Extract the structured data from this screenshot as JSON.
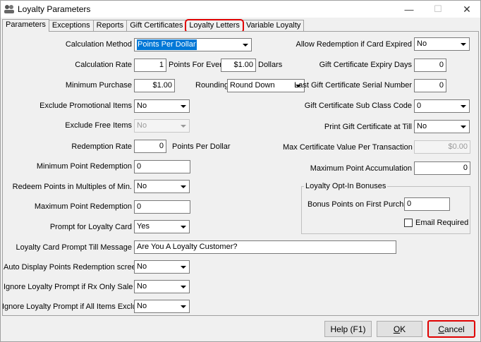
{
  "window": {
    "title": "Loyalty Parameters",
    "minimize": "—",
    "maximize": "☐",
    "close": "✕"
  },
  "tabs": [
    {
      "label": "Parameters",
      "active": true
    },
    {
      "label": "Exceptions"
    },
    {
      "label": "Reports"
    },
    {
      "label": "Gift Certificates"
    },
    {
      "label": "Loyalty Letters",
      "highlighted": true,
      "highlight_color": "#e00000"
    },
    {
      "label": "Variable Loyalty"
    }
  ],
  "left": {
    "calculation_method": {
      "label": "Calculation Method",
      "value": "Points Per Dollar"
    },
    "calculation_rate": {
      "label": "Calculation Rate",
      "value": "1",
      "mid_label": "Points For Every",
      "amount": "$1.00",
      "suffix": "Dollars"
    },
    "minimum_purchase": {
      "label": "Minimum Purchase",
      "value": "$1.00",
      "rounding_label": "Rounding",
      "rounding_value": "Round Down"
    },
    "exclude_promotional": {
      "label": "Exclude Promotional Items",
      "value": "No"
    },
    "exclude_free": {
      "label": "Exclude Free Items",
      "value": "No"
    },
    "redemption_rate": {
      "label": "Redemption Rate",
      "value": "0",
      "suffix": "Points Per Dollar"
    },
    "minimum_point_redemption": {
      "label": "Minimum Point Redemption",
      "value": "0"
    },
    "redeem_multiples": {
      "label": "Redeem Points in Multiples of Min.",
      "value": "No"
    },
    "maximum_point_redemption": {
      "label": "Maximum Point Redemption",
      "value": "0"
    },
    "prompt_for_card": {
      "label": "Prompt for Loyalty Card",
      "value": "Yes"
    },
    "prompt_message": {
      "label": "Loyalty Card Prompt Till Message",
      "value": "Are You A Loyalty Customer?"
    },
    "auto_display": {
      "label": "Auto Display Points Redemption screen",
      "value": "No"
    },
    "ignore_rx_only": {
      "label": "Ignore Loyalty Prompt if Rx Only Sale",
      "value": "No"
    },
    "ignore_all_excluded": {
      "label": "Ignore Loyalty Prompt if All Items Excluded",
      "value": "No"
    }
  },
  "right": {
    "allow_redemption_expired": {
      "label": "Allow Redemption if Card Expired",
      "value": "No"
    },
    "gift_cert_expiry_days": {
      "label": "Gift Certificate Expiry Days",
      "value": "0"
    },
    "last_gift_cert_serial": {
      "label": "Last Gift Certificate Serial Number",
      "value": "0"
    },
    "gift_cert_sub_class": {
      "label": "Gift Certificate Sub Class Code",
      "value": "0"
    },
    "print_gift_cert_till": {
      "label": "Print Gift Certificate at Till",
      "value": "No"
    },
    "max_cert_value": {
      "label": "Max Certificate Value Per Transaction",
      "value": "$0.00"
    },
    "max_point_accumulation": {
      "label": "Maximum Point Accumulation",
      "value": "0"
    },
    "opt_in": {
      "group_title": "Loyalty Opt-In Bonuses",
      "bonus_label": "Bonus Points on First Purchase",
      "bonus_value": "0",
      "email_required_label": "Email Required",
      "email_required_checked": false
    }
  },
  "buttons": {
    "help": "Help (F1)",
    "ok_underlined": "O",
    "ok_rest": "K",
    "cancel_underlined": "C",
    "cancel_rest": "ancel"
  }
}
